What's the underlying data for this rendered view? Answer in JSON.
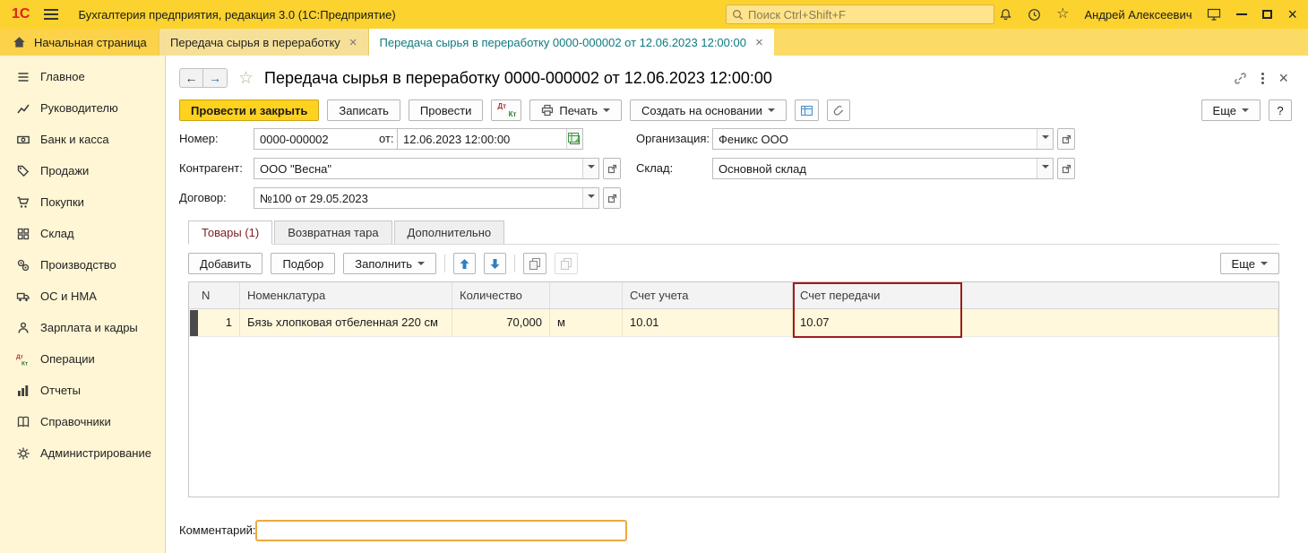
{
  "topbar": {
    "logo": "1С",
    "app_title": "Бухгалтерия предприятия, редакция 3.0  (1С:Предприятие)",
    "search_placeholder": "Поиск Ctrl+Shift+F",
    "user_name": "Андрей Алексеевич"
  },
  "tabbar": {
    "home_label": "Начальная страница",
    "tabs": [
      {
        "label": "Передача сырья в переработку"
      },
      {
        "label": "Передача сырья в переработку 0000-000002 от 12.06.2023 12:00:00"
      }
    ]
  },
  "sidebar": {
    "items": [
      {
        "label": "Главное"
      },
      {
        "label": "Руководителю"
      },
      {
        "label": "Банк и касса"
      },
      {
        "label": "Продажи"
      },
      {
        "label": "Покупки"
      },
      {
        "label": "Склад"
      },
      {
        "label": "Производство"
      },
      {
        "label": "ОС и НМА"
      },
      {
        "label": "Зарплата и кадры"
      },
      {
        "label": "Операции"
      },
      {
        "label": "Отчеты"
      },
      {
        "label": "Справочники"
      },
      {
        "label": "Администрирование"
      }
    ]
  },
  "doc": {
    "title": "Передача сырья в переработку 0000-000002 от 12.06.2023 12:00:00",
    "toolbar": {
      "post_and_close": "Провести и закрыть",
      "save": "Записать",
      "post": "Провести",
      "dt": "Дт",
      "kt": "Кт",
      "print": "Печать",
      "create_on_base": "Создать на основании",
      "more": "Еще",
      "help": "?"
    },
    "fields": {
      "number_label": "Номер:",
      "number_value": "0000-000002",
      "date_label": "от:",
      "date_value": "12.06.2023 12:00:00",
      "organization_label": "Организация:",
      "organization_value": "Феникс ООО",
      "counterparty_label": "Контрагент:",
      "counterparty_value": "ООО \"Весна\"",
      "warehouse_label": "Склад:",
      "warehouse_value": "Основной склад",
      "contract_label": "Договор:",
      "contract_value": "№100 от 29.05.2023"
    },
    "tabs": [
      {
        "label": "Товары (1)"
      },
      {
        "label": "Возвратная тара"
      },
      {
        "label": "Дополнительно"
      }
    ],
    "grid_toolbar": {
      "add": "Добавить",
      "pick": "Подбор",
      "fill": "Заполнить",
      "more": "Еще"
    },
    "grid": {
      "columns": {
        "n": "N",
        "nomenclature": "Номенклатура",
        "quantity": "Количество",
        "unit": "",
        "account": "Счет учета",
        "transfer_account": "Счет передачи"
      },
      "rows": [
        {
          "n": "1",
          "nomenclature": "Бязь хлопковая отбеленная 220 см",
          "quantity": "70,000",
          "unit": "м",
          "account": "10.01",
          "transfer_account": "10.07"
        }
      ]
    },
    "comment_label": "Комментарий:",
    "comment_value": ""
  },
  "colors": {
    "accent_yellow": "#fcd22e",
    "primary_button": "#ffd21f",
    "active_tab_text": "#0c7a80",
    "selected_row": "#fff8dc",
    "highlight_border": "#9e1c1c",
    "comment_focus_border": "#eca93c"
  }
}
